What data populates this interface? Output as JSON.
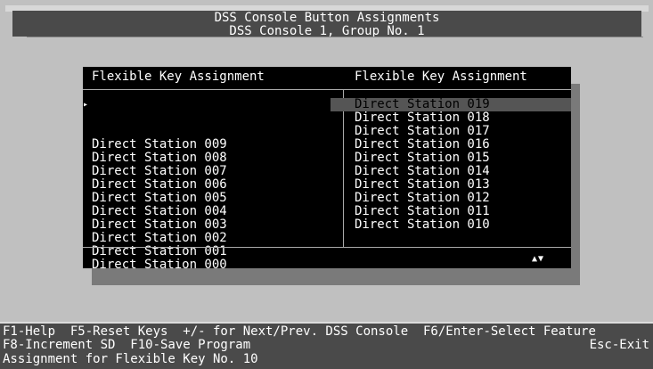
{
  "title": {
    "line1": "DSS Console Button Assignments",
    "line2": "DSS Console 1, Group No. 1"
  },
  "panel": {
    "left_header": "Flexible Key Assignment",
    "right_header": "Flexible Key Assignment",
    "cursor_glyph": "▸",
    "scroll_glyph": "▲▼",
    "left_items": [
      "Direct Station 009",
      "Direct Station 008",
      "Direct Station 007",
      "Direct Station 006",
      "Direct Station 005",
      "Direct Station 004",
      "Direct Station 003",
      "Direct Station 002",
      "Direct Station 001",
      "Direct Station 000"
    ],
    "right_items": [
      "Direct Station 019",
      "Direct Station 018",
      "Direct Station 017",
      "Direct Station 016",
      "Direct Station 015",
      "Direct Station 014",
      "Direct Station 013",
      "Direct Station 012",
      "Direct Station 011",
      "Direct Station 010"
    ],
    "selected_right_index": 0
  },
  "footer": {
    "line1": "F1-Help  F5-Reset Keys  +/- for Next/Prev. DSS Console  F6/Enter-Select Feature",
    "line2": "F8-Increment SD  F10-Save Program",
    "esc": "Esc-Exit",
    "status": "Assignment for Flexible Key No. 10"
  },
  "colors": {
    "background": "#c0c0c0",
    "title_bar": "#4a4a4a",
    "panel": "#000000",
    "selection": "#555555",
    "text": "#ffffff"
  }
}
